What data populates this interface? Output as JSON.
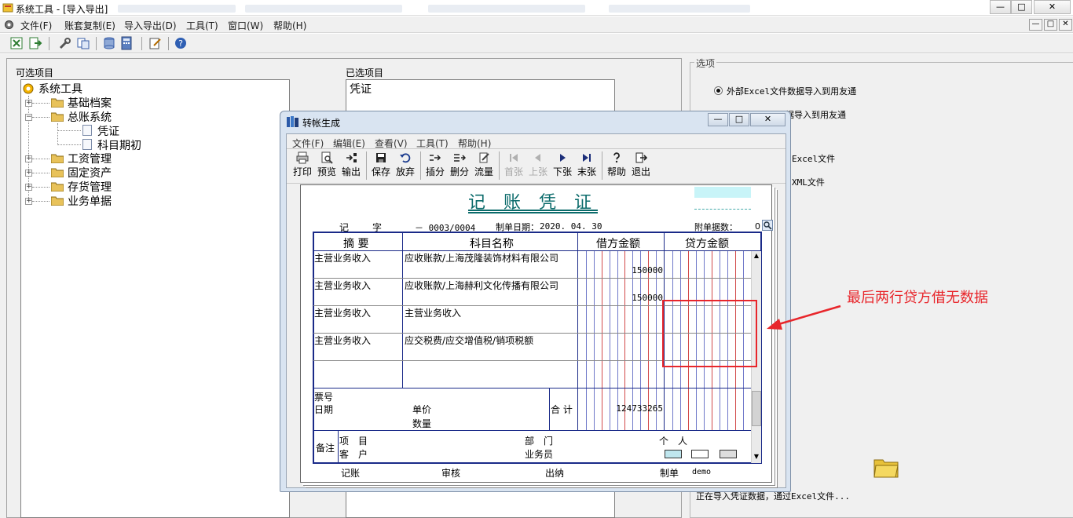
{
  "window": {
    "title": "系统工具 - [导入导出]",
    "buttons": {
      "minimize": "—",
      "maximize": "□",
      "close": "✕"
    }
  },
  "menubar": {
    "items": [
      "文件(F)",
      "账套复制(E)",
      "导入导出(D)",
      "工具(T)",
      "窗口(W)",
      "帮助(H)"
    ]
  },
  "left_panel": {
    "label": "可选项目",
    "tree": {
      "root": "系统工具",
      "nodes": [
        {
          "label": "基础档案",
          "children": []
        },
        {
          "label": "总账系统",
          "children": [
            "凭证",
            "科目期初"
          ]
        },
        {
          "label": "工资管理",
          "children": []
        },
        {
          "label": "固定资产",
          "children": []
        },
        {
          "label": "存货管理",
          "children": []
        },
        {
          "label": "业务单据",
          "children": []
        }
      ]
    }
  },
  "middle_panel": {
    "label": "已选项目",
    "items": [
      "凭证"
    ]
  },
  "options_panel": {
    "label": "选项",
    "radio_1": "外部Excel文件数据导入到用友通",
    "radio_2_partial": "据导入到用友通",
    "opt_3_partial": "Excel文件",
    "opt_4_partial": "XML文件",
    "status": "正在导入凭证数据，通过Excel文件..."
  },
  "dialog": {
    "title": "转帐生成",
    "menu": [
      "文件(F)",
      "编辑(E)",
      "查看(V)",
      "工具(T)",
      "帮助(H)"
    ],
    "toolbar": [
      {
        "label": "打印",
        "icon": "printer-icon",
        "enabled": true
      },
      {
        "label": "预览",
        "icon": "preview-icon",
        "enabled": true
      },
      {
        "label": "输出",
        "icon": "export-icon",
        "enabled": true
      },
      {
        "label": "保存",
        "icon": "save-icon",
        "enabled": true
      },
      {
        "label": "放弃",
        "icon": "undo-icon",
        "enabled": true
      },
      {
        "label": "插分",
        "icon": "insert-row-icon",
        "enabled": true
      },
      {
        "label": "删分",
        "icon": "delete-row-icon",
        "enabled": true
      },
      {
        "label": "流量",
        "icon": "cashflow-icon",
        "enabled": true
      },
      {
        "label": "首张",
        "icon": "first-icon",
        "enabled": false
      },
      {
        "label": "上张",
        "icon": "prev-icon",
        "enabled": false
      },
      {
        "label": "下张",
        "icon": "next-icon",
        "enabled": true
      },
      {
        "label": "末张",
        "icon": "last-icon",
        "enabled": true
      },
      {
        "label": "帮助",
        "icon": "help-icon",
        "enabled": true
      },
      {
        "label": "退出",
        "icon": "exit-icon",
        "enabled": true
      }
    ]
  },
  "voucher": {
    "title": "记 账 凭 证",
    "type_label": "记",
    "zi_label": "字",
    "number": "－ 0003/0004",
    "date_label": "制单日期：",
    "date": "2020. 04. 30",
    "attach_label": "附单据数：",
    "attach_count": "0",
    "columns": {
      "summary": "摘 要",
      "account": "科目名称",
      "debit": "借方金额",
      "credit": "贷方金额"
    },
    "rows": [
      {
        "summary": "主营业务收入",
        "account": "应收账款/上海茂隆装饰材料有限公司",
        "debit": "150000",
        "credit": ""
      },
      {
        "summary": "主营业务收入",
        "account": "应收账款/上海赫利文化传播有限公司",
        "debit": "150000",
        "credit": ""
      },
      {
        "summary": "主营业务收入",
        "account": "主营业务收入",
        "debit": "",
        "credit": ""
      },
      {
        "summary": "主营业务收入",
        "account": "应交税费/应交增值税/销项税额",
        "debit": "",
        "credit": ""
      },
      {
        "summary": "",
        "account": "",
        "debit": "",
        "credit": ""
      }
    ],
    "footer": {
      "ticket_no": "票号",
      "date": "日期",
      "unit_price": "单价",
      "quantity": "数量",
      "total_label": "合 计",
      "total_debit": "124733265"
    },
    "remark": {
      "label": "备注",
      "project": "项　目",
      "customer": "客　户",
      "dept": "部　门",
      "salesman": "业务员",
      "person": "个　人"
    },
    "signatures": {
      "bookkeeping": "记账",
      "audit": "审核",
      "cashier": "出纳",
      "maker_label": "制单",
      "maker": "demo"
    }
  },
  "annotation": {
    "text": "最后两行贷方借无数据",
    "color": "#e8262b"
  }
}
